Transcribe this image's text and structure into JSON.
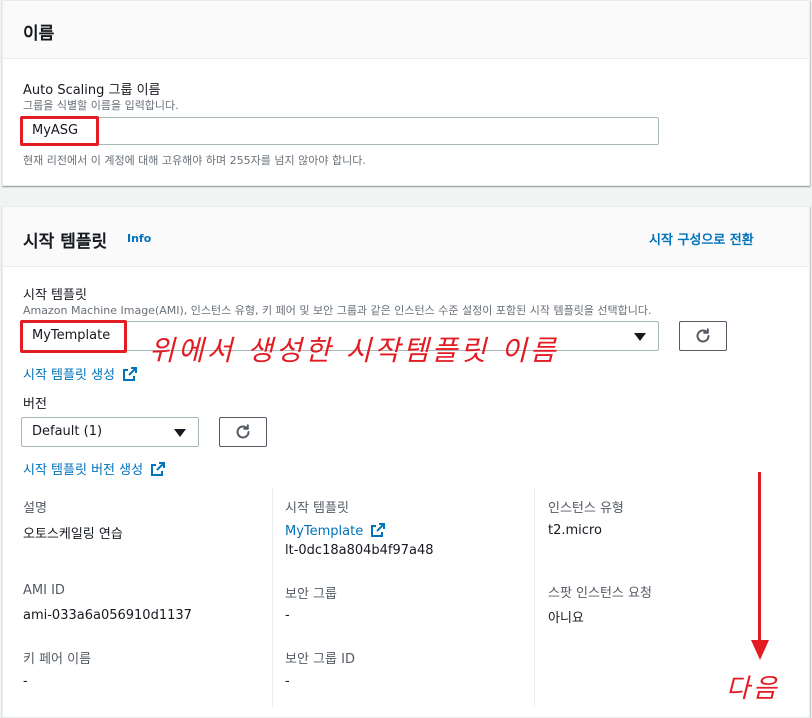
{
  "name_section": {
    "title": "이름",
    "asg_label": "Auto Scaling 그룹 이름",
    "asg_desc": "그룹을 식별할 이름을 입력합니다.",
    "asg_value": "MyASG",
    "asg_hint": "현재 리전에서 이 계정에 대해 고유해야 하며 255자를 넘지 않아야 합니다."
  },
  "template_section": {
    "title": "시작 템플릿",
    "info": "Info",
    "switch_link": "시작 구성으로 전환",
    "template_label": "시작 템플릿",
    "template_desc": "Amazon Machine Image(AMI), 인스턴스 유형, 키 페어 및 보안 그룹과 같은 인스턴스 수준 설정이 포함된 시작 템플릿을 선택합니다.",
    "template_value": "MyTemplate",
    "create_template_link": "시작 템플릿 생성",
    "version_label": "버전",
    "version_value": "Default (1)",
    "create_version_link": "시작 템플릿 버전 생성",
    "details": {
      "desc_label": "설명",
      "desc_value": "오토스케일링 연습",
      "tmpl_label": "시작 템플릿",
      "tmpl_link": "MyTemplate",
      "tmpl_id": "lt-0dc18a804b4f97a48",
      "itype_label": "인스턴스 유형",
      "itype_value": "t2.micro",
      "ami_label": "AMI ID",
      "ami_value": "ami-033a6a056910d1137",
      "sg_label": "보안 그룹",
      "sg_value": "-",
      "spot_label": "스팟 인스턴스 요청",
      "spot_value": "아니요",
      "key_label": "키 페어 이름",
      "key_value": "-",
      "sgid_label": "보안 그룹 ID",
      "sgid_value": "-"
    }
  },
  "annotations": {
    "template_note": "위에서 생성한 시작템플릿 이름",
    "next_note": "다음",
    "color": "#e31b23"
  },
  "colors": {
    "link": "#0073bb",
    "border": "#aab7b8"
  }
}
